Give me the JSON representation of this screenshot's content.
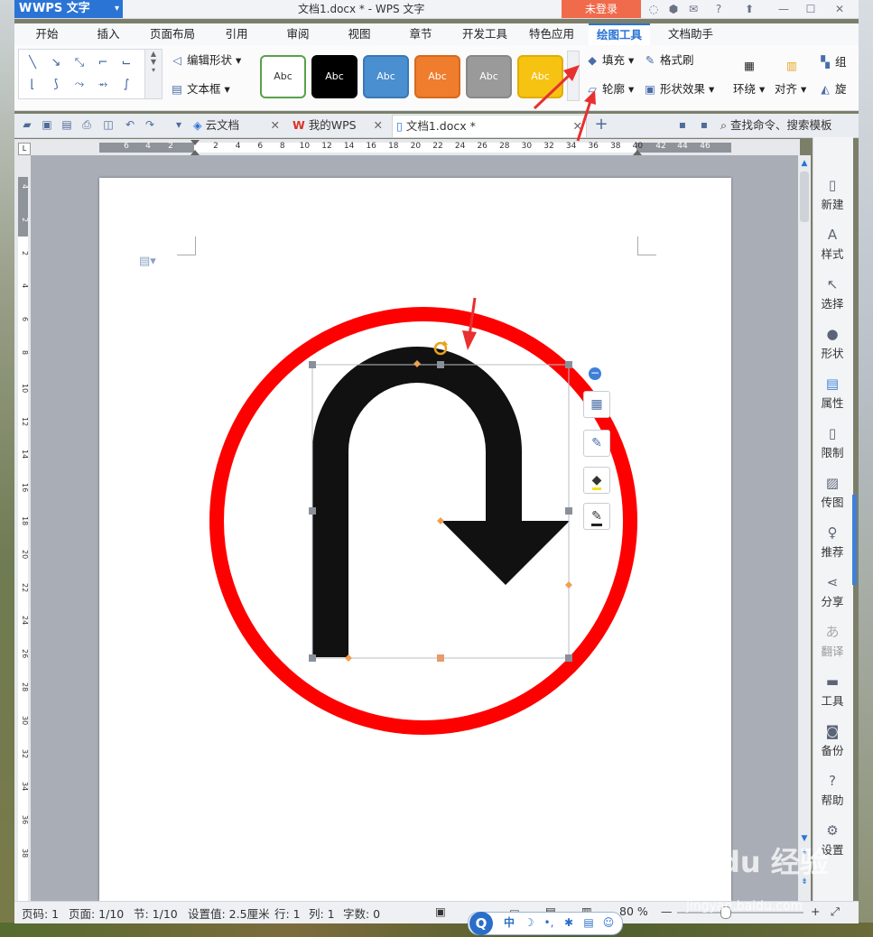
{
  "app": {
    "name": "WPS 文字",
    "doc_title": "文档1.docx * - WPS 文字",
    "login_label": "未登录"
  },
  "menu": {
    "tabs": [
      "开始",
      "插入",
      "页面布局",
      "引用",
      "审阅",
      "视图",
      "章节",
      "开发工具",
      "特色应用",
      "绘图工具",
      "文档助手"
    ],
    "active": "绘图工具"
  },
  "ribbon": {
    "edit_shape": "编辑形状",
    "text_box": "文本框",
    "style_label": "Abc",
    "styles": [
      {
        "bg": "#ffffff",
        "fg": "#333333",
        "border": "#5aa04a"
      },
      {
        "bg": "#000000",
        "fg": "#ffffff",
        "border": "#000000"
      },
      {
        "bg": "#4a8fd0",
        "fg": "#ffffff",
        "border": "#3a78b5"
      },
      {
        "bg": "#ef7d2d",
        "fg": "#ffffff",
        "border": "#d66a1e"
      },
      {
        "bg": "#9a9a9a",
        "fg": "#ffffff",
        "border": "#888888"
      },
      {
        "bg": "#f7c312",
        "fg": "#ffffff",
        "border": "#e0ad05"
      }
    ],
    "fill": "填充",
    "format_brush": "格式刷",
    "outline": "轮廓",
    "shape_effect": "形状效果",
    "wrap": "环绕",
    "align": "对齐",
    "group_prefix": "组",
    "rotate_prefix": "旋"
  },
  "tabs": {
    "cloud": "云文档",
    "mywps": "我的WPS",
    "doc": "文档1.docx *",
    "search": "查找命令、搜索模板"
  },
  "ruler": {
    "h_dark_left": [
      "6",
      "4",
      "2"
    ],
    "h_marks": [
      "2",
      "4",
      "6",
      "8",
      "10",
      "12",
      "14",
      "16",
      "18",
      "20",
      "22",
      "24",
      "26",
      "28",
      "30",
      "32",
      "34",
      "36",
      "38",
      "40"
    ],
    "h_dark_right": [
      "42",
      "44",
      "46"
    ],
    "v_marks": [
      "4",
      "2",
      "2",
      "4",
      "6",
      "8",
      "10",
      "12",
      "14",
      "16",
      "18",
      "20",
      "22",
      "24",
      "26",
      "28",
      "30",
      "32",
      "34",
      "36",
      "38"
    ]
  },
  "taskpane": [
    {
      "label": "新建",
      "icon": "new-doc-icon"
    },
    {
      "label": "样式",
      "icon": "style-icon"
    },
    {
      "label": "选择",
      "icon": "select-icon"
    },
    {
      "label": "形状",
      "icon": "shape-icon"
    },
    {
      "label": "属性",
      "icon": "property-icon"
    },
    {
      "label": "限制",
      "icon": "restrict-icon"
    },
    {
      "label": "传图",
      "icon": "upload-image-icon"
    },
    {
      "label": "推荐",
      "icon": "recommend-icon"
    },
    {
      "label": "分享",
      "icon": "share-icon"
    },
    {
      "label": "翻译",
      "icon": "translate-icon"
    },
    {
      "label": "工具",
      "icon": "toolbox-icon"
    },
    {
      "label": "备份",
      "icon": "backup-icon"
    },
    {
      "label": "帮助",
      "icon": "help-icon"
    },
    {
      "label": "设置",
      "icon": "settings-icon"
    }
  ],
  "status": {
    "page_code": "页码: 1",
    "page": "页面: 1/10",
    "section": "节: 1/10",
    "setting": "设置值: 2.5厘米",
    "row": "行: 1",
    "col": "列: 1",
    "words": "字数: 0",
    "zoom": "80 %"
  },
  "ime": {
    "lang": "中"
  },
  "watermark": {
    "text": "Baidu 经验",
    "url": "jingyan.baidu.com"
  },
  "colors": {
    "accent": "#2a74d6",
    "sign_ring": "#ff0000",
    "arrow": "#111111",
    "login": "#f06b4c",
    "annotation": "#e83030"
  }
}
